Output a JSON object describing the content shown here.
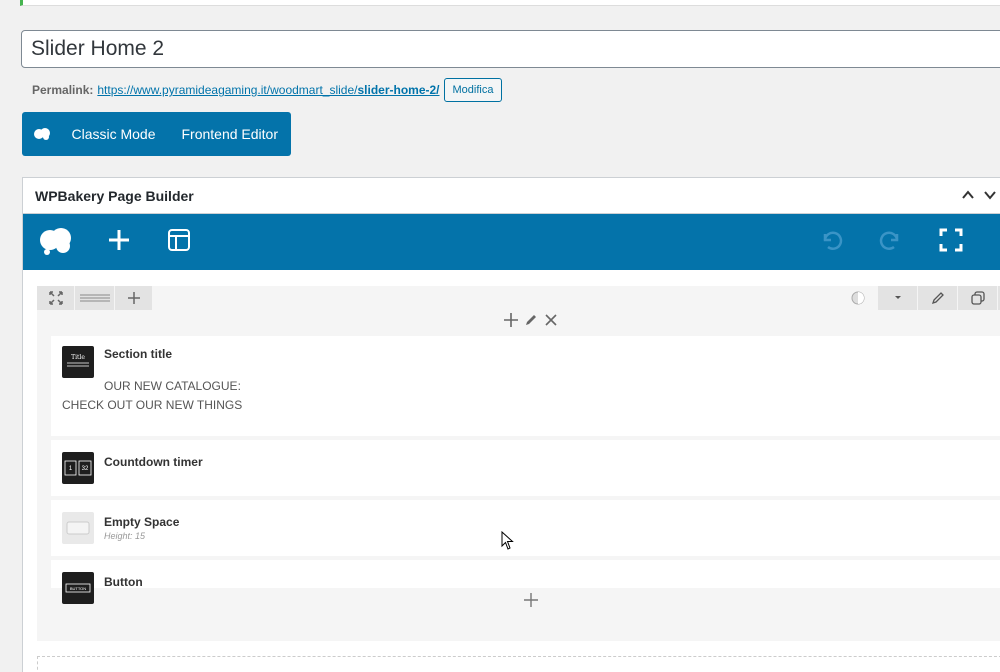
{
  "title_input": {
    "value": "Slider Home 2"
  },
  "permalink": {
    "label": "Permalink:",
    "url_prefix": "https://www.pyramideagaming.it/woodmart_slide/",
    "url_slug": "slider-home-2/",
    "edit_label": "Modifica"
  },
  "mode_bar": {
    "classic_label": "Classic Mode",
    "frontend_label": "Frontend Editor"
  },
  "panel": {
    "title": "WPBakery Page Builder"
  },
  "elements": [
    {
      "title": "Section title",
      "line1": "OUR NEW CATALOGUE:",
      "line2": "CHECK OUT OUR NEW THINGS"
    },
    {
      "title": "Countdown timer"
    },
    {
      "title": "Empty Space",
      "subtitle": "Height: 15"
    },
    {
      "title": "Button"
    }
  ],
  "icons": {
    "section_title": "Title",
    "countdown": [
      "1",
      "32"
    ],
    "button": "BUTTON"
  },
  "colors": {
    "brand_blue": "#0473aa",
    "link_blue": "#0073aa"
  }
}
